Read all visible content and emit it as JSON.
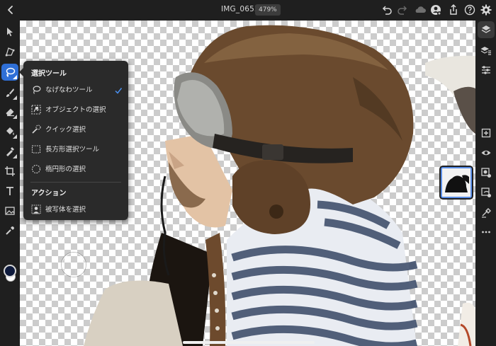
{
  "header": {
    "title": "IMG_0655",
    "zoom": "479%"
  },
  "icons": {
    "back": "chevron-left-icon",
    "undo": "undo-icon",
    "redo": "redo-icon",
    "cloud": "cloud-icon",
    "account": "account-icon",
    "share": "share-icon",
    "help": "help-icon",
    "settings": "gear-icon"
  },
  "left_toolbar": {
    "tools": [
      "move-tool",
      "transform-tool",
      "selection-tool",
      "brush-tool",
      "eraser-tool",
      "fill-tool",
      "heal-tool",
      "crop-tool",
      "type-tool",
      "image-tool",
      "eyedropper-tool"
    ],
    "active_tool": "selection-tool",
    "foreground_color": "#0e1a3c",
    "background_color": "#ffffff"
  },
  "selection_menu": {
    "section_title": "選択ツール",
    "items": [
      {
        "label": "なげなわツール",
        "icon": "lasso-icon",
        "checked": true
      },
      {
        "label": "オブジェクトの選択",
        "icon": "object-select-icon",
        "checked": false
      },
      {
        "label": "クイック選択",
        "icon": "quick-select-icon",
        "checked": false
      },
      {
        "label": "長方形選択ツール",
        "icon": "rect-marquee-icon",
        "checked": false
      },
      {
        "label": "楕円形の選択",
        "icon": "ellipse-marquee-icon",
        "checked": false
      }
    ],
    "actions_title": "アクション",
    "actions": [
      {
        "label": "被写体を選択",
        "icon": "select-subject-icon"
      }
    ]
  },
  "right_toolbar": {
    "tools": [
      "layers-icon",
      "layer-properties-icon",
      "adjustments-icon",
      "add-layer-icon",
      "visibility-icon",
      "mask-icon",
      "clip-icon",
      "fx-icon",
      "more-icon"
    ],
    "active": "layers-icon"
  },
  "colors": {
    "accent": "#2f6fd6",
    "check": "#4a90f0",
    "panel": "#2a2a2a",
    "toolbar": "#1f1f1f"
  }
}
